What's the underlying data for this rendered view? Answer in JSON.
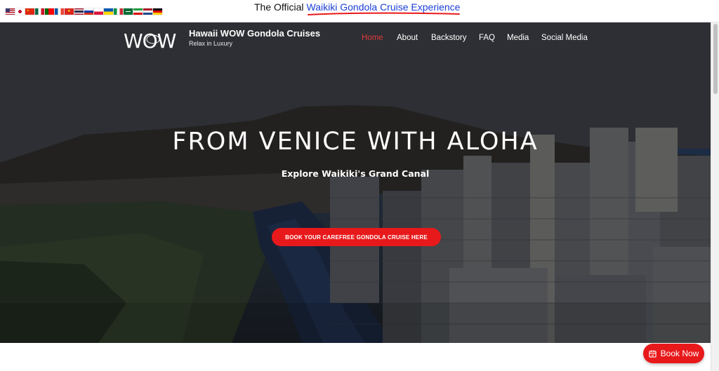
{
  "topbar": {
    "flags": [
      {
        "name": "flag-us",
        "colors": [
          "#b22234",
          "#ffffff",
          "#3c3b6e"
        ]
      },
      {
        "name": "flag-japan",
        "colors": [
          "#ffffff",
          "#bc002d"
        ]
      },
      {
        "name": "flag-china",
        "colors": [
          "#de2910",
          "#ffde00"
        ]
      },
      {
        "name": "flag-mexico",
        "colors": [
          "#006847",
          "#ffffff",
          "#ce1126"
        ]
      },
      {
        "name": "flag-portugal",
        "colors": [
          "#006600",
          "#ff0000"
        ]
      },
      {
        "name": "flag-france",
        "colors": [
          "#0055a4",
          "#ffffff",
          "#ef4135"
        ]
      },
      {
        "name": "flag-vietnam",
        "colors": [
          "#da251d",
          "#ffff00"
        ]
      },
      {
        "name": "flag-thailand",
        "colors": [
          "#a51931",
          "#f4f5f8",
          "#2d2a4a"
        ]
      },
      {
        "name": "flag-russia",
        "colors": [
          "#ffffff",
          "#0039a6",
          "#d52b1e"
        ]
      },
      {
        "name": "flag-poland",
        "colors": [
          "#ffffff",
          "#dc143c"
        ]
      },
      {
        "name": "flag-ukraine",
        "colors": [
          "#0057b7",
          "#ffd700"
        ]
      },
      {
        "name": "flag-italy",
        "colors": [
          "#009246",
          "#ffffff",
          "#ce2b37"
        ]
      },
      {
        "name": "flag-saudi",
        "colors": [
          "#006c35",
          "#ffffff"
        ]
      },
      {
        "name": "flag-iran",
        "colors": [
          "#239f40",
          "#ffffff",
          "#da0000"
        ]
      },
      {
        "name": "flag-netherlands",
        "colors": [
          "#ae1c28",
          "#ffffff",
          "#21468b"
        ]
      },
      {
        "name": "flag-germany",
        "colors": [
          "#000000",
          "#dd0000",
          "#ffce00"
        ]
      }
    ],
    "announce_prefix": "The Official",
    "announce_highlight": "Waikiki Gondola Cruise Experience"
  },
  "header": {
    "logo_text": "WOW",
    "brand_name": "Hawaii WOW Gondola Cruises",
    "tagline": "Relax in Luxury"
  },
  "nav": {
    "items": [
      {
        "label": "Home",
        "active": true
      },
      {
        "label": "About",
        "active": false
      },
      {
        "label": "Backstory",
        "active": false
      },
      {
        "label": "FAQ",
        "active": false
      },
      {
        "label": "Media",
        "active": false
      },
      {
        "label": "Social Media",
        "active": false
      }
    ]
  },
  "hero": {
    "headline": "FROM VENICE WITH ALOHA",
    "subhead": "Explore Waikiki's Grand Canal",
    "cta_label": "BOOK YOUR CAREFREE GONDOLA CRUISE HERE"
  },
  "floating": {
    "book_now_label": "Book Now"
  },
  "colors": {
    "accent_red": "#e8191b",
    "nav_active": "#e0393b",
    "link_blue": "#1b3fd6"
  }
}
